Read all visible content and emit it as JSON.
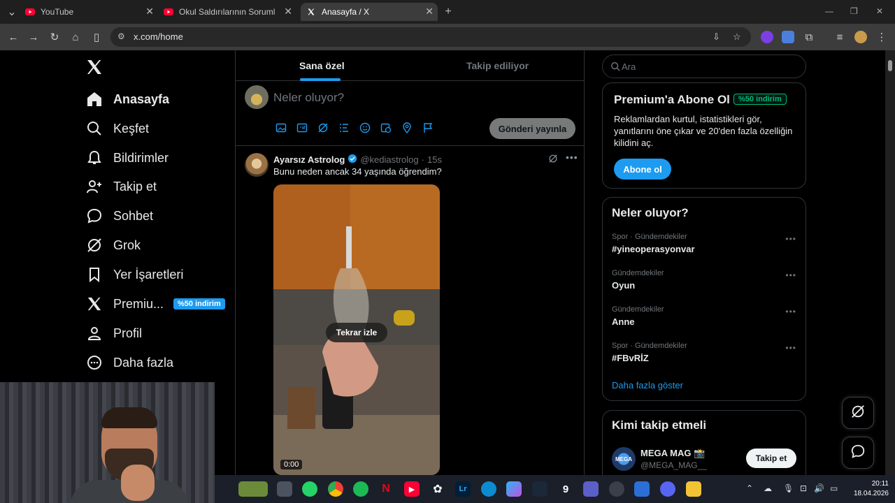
{
  "browser": {
    "tabs": [
      {
        "label": "YouTube",
        "icon": "youtube-icon",
        "active": false
      },
      {
        "label": "Okul Saldırılarının Sorumlusu Ai",
        "icon": "youtube-icon",
        "active": false
      },
      {
        "label": "Anasayfa / X",
        "icon": "x-logo-icon",
        "active": true
      }
    ],
    "url": "x.com/home"
  },
  "sidebar": {
    "items": [
      {
        "label": "Anasayfa",
        "icon": "home-icon"
      },
      {
        "label": "Keşfet",
        "icon": "search-icon"
      },
      {
        "label": "Bildirimler",
        "icon": "bell-icon"
      },
      {
        "label": "Takip et",
        "icon": "add-user-icon"
      },
      {
        "label": "Sohbet",
        "icon": "chat-icon"
      },
      {
        "label": "Grok",
        "icon": "grok-icon"
      },
      {
        "label": "Yer İşaretleri",
        "icon": "bookmark-icon"
      },
      {
        "label": "Premiu...",
        "icon": "x-logo-icon",
        "badge": "%50 indirim"
      },
      {
        "label": "Profil",
        "icon": "person-icon"
      },
      {
        "label": "Daha fazla",
        "icon": "more-circle-icon"
      }
    ]
  },
  "timeline": {
    "tabs": [
      "Sana özel",
      "Takip ediliyor"
    ],
    "composer": {
      "placeholder": "Neler oluyor?",
      "post_button": "Gönderi yayınla"
    },
    "tweet": {
      "name": "Ayarsız Astrolog",
      "handle": "@kediastrolog",
      "time": "15s",
      "text": "Bunu neden ancak 34 yaşında öğrendim?",
      "replay_label": "Tekrar izle",
      "video_time": "0:00"
    }
  },
  "right": {
    "search_placeholder": "Ara",
    "premium": {
      "title": "Premium'a Abone Ol",
      "badge": "%50 indirim",
      "text": "Reklamlardan kurtul, istatistikleri gör, yanıtlarını öne çıkar ve 20'den fazla özelliğin kilidini aç.",
      "button": "Abone ol"
    },
    "trends": {
      "title": "Neler oluyor?",
      "items": [
        {
          "category": "Spor · Gündemdekiler",
          "name": "#yineoperasyonvar"
        },
        {
          "category": "Gündemdekiler",
          "name": "Oyun"
        },
        {
          "category": "Gündemdekiler",
          "name": "Anne"
        },
        {
          "category": "Spor · Gündemdekiler",
          "name": "#FBvRİZ"
        }
      ],
      "more": "Daha fazla göster"
    },
    "who_to_follow": {
      "title": "Kimi takip etmeli",
      "name": "MEGA MAG 📸",
      "handle": "@MEGA_MAG__",
      "avatar_text": "MEGA",
      "button": "Takip et"
    }
  },
  "taskbar": {
    "time": "20:11",
    "date": "18.04.2026"
  },
  "colors": {
    "accent": "#1d9bf0",
    "background": "#000000",
    "border": "#2f3336",
    "premium_badge": "#00ba7c"
  }
}
